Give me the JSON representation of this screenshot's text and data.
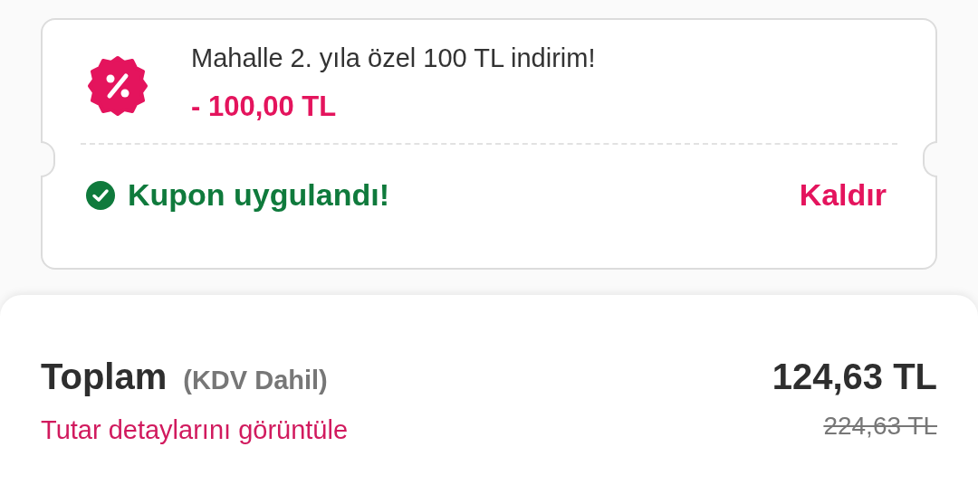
{
  "coupon": {
    "title": "Mahalle 2. yıla özel 100 TL indirim!",
    "discount": "- 100,00 TL",
    "status": "Kupon uygulandı!",
    "applied": true,
    "remove_label": "Kaldır"
  },
  "total": {
    "label": "Toplam",
    "note": "(KDV Dahil)",
    "details_link": "Tutar detaylarını görüntüle",
    "amount": "124,63 TL",
    "original_amount": "224,63 TL"
  }
}
